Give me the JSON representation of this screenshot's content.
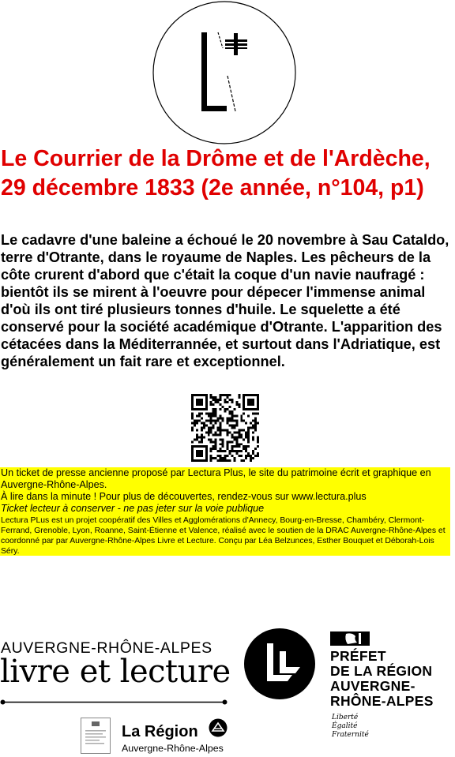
{
  "header": {
    "logo_icon": "lectura-plus-circle-logo"
  },
  "article": {
    "title": "Le Courrier de la Drôme et de l'Ardèche, 29 décembre 1833 (2e année, n°104, p1)",
    "body": "Le cadavre d'une baleine a échoué le 20 novembre à Sau Cataldo, terre d'Otrante, dans le royaume de Naples. Les pêcheurs de la côte crurent d'abord que c'était la coque d'un navie naufragé : bientôt ils se mirent à l'oeuvre pour dépecer l'immense animal d'où ils ont tiré plusieurs tonnes d'huile. Le squelette a été conservé pour la société académique d'Otrante. L'apparition des cétacées dans la Méditerrannée, et surtout dans l'Adriatique, est généralement un fait rare et exceptionnel."
  },
  "qr": {
    "icon": "qr-code"
  },
  "ticket": {
    "background": "#ffff00",
    "intro": "Un ticket de presse ancienne proposé par Lectura Plus, le site du patrimoine écrit et graphique en Auvergne-Rhône-Alpes.",
    "read_more": "À lire dans la minute ! Pour plus de découvertes, rendez-vous sur www.lectura.plus",
    "notice": "Ticket lecteur à conserver - ne pas jeter sur la voie publique",
    "credits": "Lectura PLus est un projet coopératif des Villes et Agglomérations d'Annecy, Bourg-en-Bresse, Chambéry, Clermont-Ferrand, Grenoble, Lyon, Roanne, Saint-Étienne et Valence, réalisé avec le soutien de la DRAC Auvergne-Rhône-Alpes et coordonné par par Auvergne-Rhône-Alpes Livre et Lecture. Conçu par Léa Belzunces, Esther Bouquet et Déborah-Lois Séry."
  },
  "partners": {
    "arl_top": "AUVERGNE-RHÔNE-ALPES",
    "arl_bottom": "livre et lecture",
    "prefet_lines": [
      "PRÉFET",
      "DE LA RÉGION",
      "AUVERGNE-",
      "RHÔNE-ALPES"
    ],
    "prefet_motto": [
      "Liberté",
      "Égalité",
      "Fraternité"
    ],
    "region_name": "La Région",
    "region_sub": "Auvergne-Rhône-Alpes",
    "title_color": "#e00000"
  }
}
